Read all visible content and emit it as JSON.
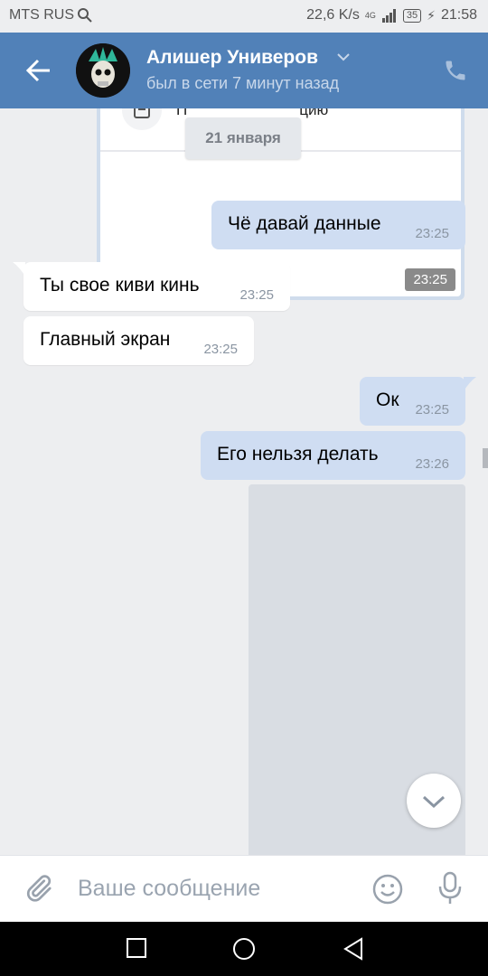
{
  "status_bar": {
    "carrier": "MTS RUS",
    "speed": "22,6 K/s",
    "network": "4G",
    "battery": "35",
    "time": "21:58"
  },
  "header": {
    "contact_name": "Алишер Универов",
    "status": "был в сети 7 минут назад",
    "back_icon": "arrow-left-icon",
    "call_icon": "phone-icon"
  },
  "chat": {
    "shared_card": {
      "text_start": "П",
      "text_end": "цию",
      "time": "23:25"
    },
    "date_badge": "21 января",
    "messages": [
      {
        "direction": "out",
        "text": "Чё давай данные",
        "time": "23:25"
      },
      {
        "direction": "in",
        "text": "Ты свое киви кинь",
        "time": "23:25"
      },
      {
        "direction": "in",
        "text": "Главный экран",
        "time": "23:25"
      },
      {
        "direction": "out",
        "text": "Ок",
        "time": "23:25"
      },
      {
        "direction": "out",
        "text": "Его нельзя делать",
        "time": "23:26"
      }
    ]
  },
  "composer": {
    "placeholder": "Ваше сообщение"
  },
  "colors": {
    "header_bg": "#5181b8",
    "outgoing_bubble": "#cfddf2",
    "incoming_bubble": "#ffffff",
    "chat_bg": "#edeef0"
  }
}
